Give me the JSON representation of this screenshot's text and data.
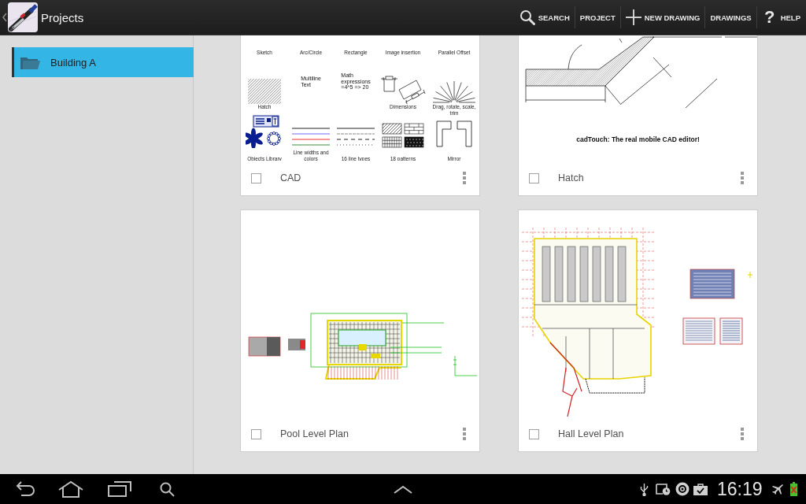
{
  "action_bar": {
    "title": "Projects",
    "actions": [
      {
        "label": "SEARCH",
        "kind": "search"
      },
      {
        "label": "PROJECT",
        "kind": "text"
      },
      {
        "label": "NEW DRAWING",
        "kind": "plus"
      },
      {
        "label": "DRAWINGS",
        "kind": "text"
      },
      {
        "label": "HELP",
        "kind": "glyph",
        "glyph": "?"
      }
    ]
  },
  "sidebar": {
    "items": [
      {
        "label": "Building A",
        "selected": true
      }
    ]
  },
  "drawings": [
    {
      "title": "CAD",
      "checked": false,
      "preview": {
        "kind": "feature_sheet",
        "rows": [
          [
            {
              "caption": "Sketch"
            },
            {
              "caption": "Arc/Circle"
            },
            {
              "caption": "Rectangle"
            },
            {
              "caption": "Image insertion"
            },
            {
              "caption": "Parallel Offset"
            }
          ],
          [
            {
              "kind": "hatch",
              "caption": "Hatch"
            },
            {
              "kind": "text",
              "text": "Multiline\nText"
            },
            {
              "kind": "text",
              "text": "Math\nexpressions\n=4^5 => 20"
            },
            {
              "kind": "dimensions",
              "caption": "Dimensions"
            },
            {
              "kind": "rays",
              "caption": "Drag, rotate, scale, trim"
            }
          ],
          [
            {
              "kind": "library",
              "caption": "Objects Library"
            },
            {
              "kind": "line_widths",
              "caption": "Line widths and colors"
            },
            {
              "kind": "line_types",
              "caption": "16 line types"
            },
            {
              "kind": "patterns",
              "caption": "18 patterns"
            },
            {
              "kind": "mirror",
              "caption": "Mirror"
            }
          ]
        ]
      }
    },
    {
      "title": "Hatch",
      "checked": false,
      "preview": {
        "kind": "hatch_detail",
        "caption": "cadTouch: The real mobile CAD editor!"
      }
    },
    {
      "title": "Pool Level Plan",
      "checked": false,
      "preview": {
        "kind": "pool_plan"
      }
    },
    {
      "title": "Hall Level Plan",
      "checked": false,
      "preview": {
        "kind": "hall_plan"
      }
    }
  ],
  "nav_bar": {
    "time": "16:19"
  }
}
